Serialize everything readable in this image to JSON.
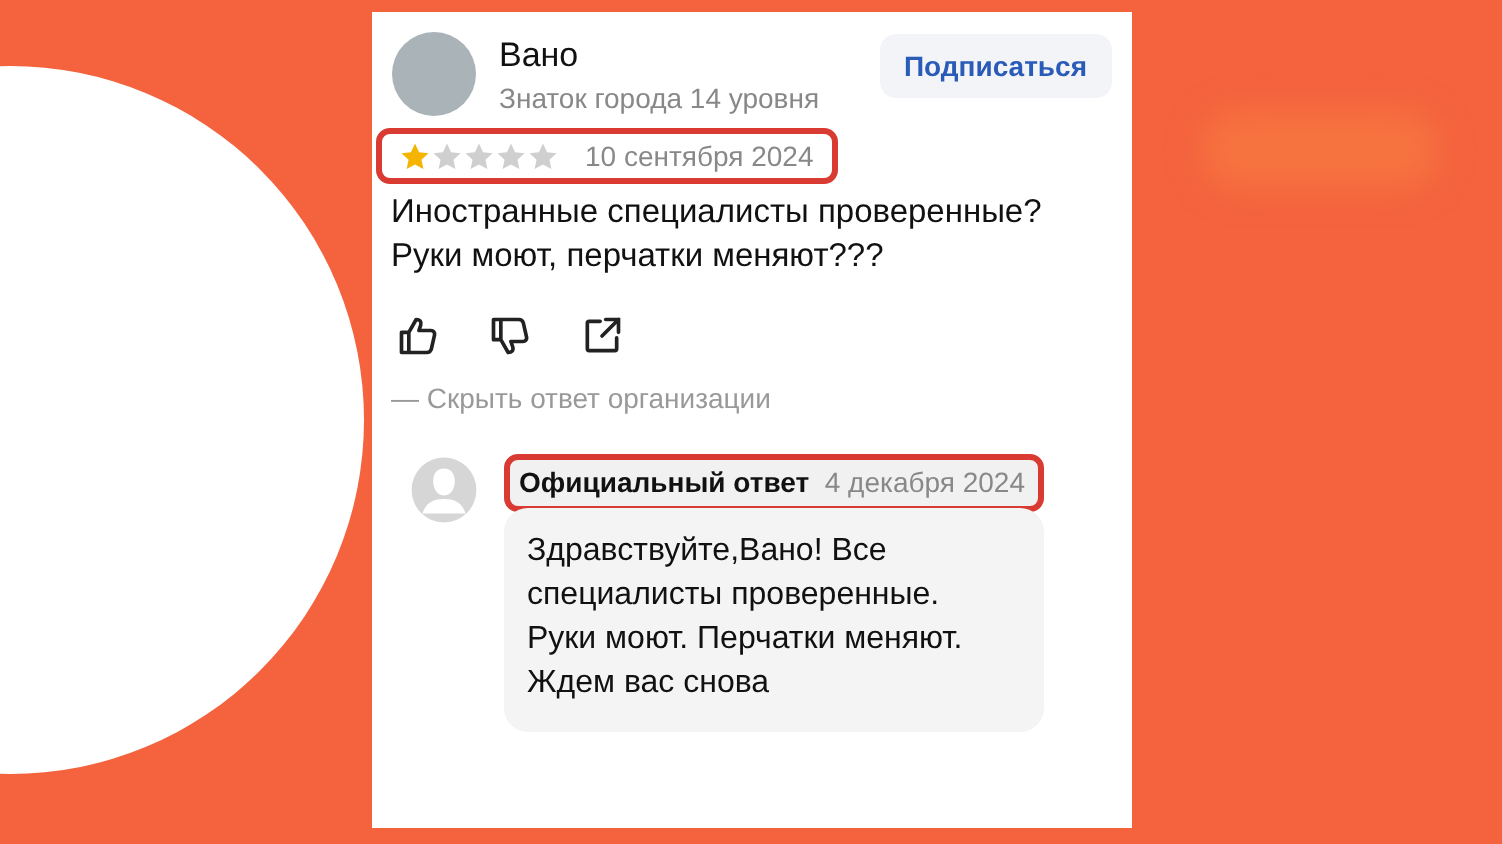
{
  "review": {
    "author": "Вано",
    "author_level": "Знаток города 14 уровня",
    "subscribe_button": "Подписаться",
    "stars": 1,
    "date": "10 сентября 2024",
    "highlighted": true,
    "text": "Иностранные специалисты проверенные?\nРуки моют, перчатки меняют???",
    "toggle_reply": "— Скрыть ответ организации"
  },
  "reply": {
    "title": "Официальный ответ",
    "date": "4 декабря 2024",
    "highlighted": true,
    "text": "Здравствуйте,Вано! Все\nспециалисты проверенные.\nРуки моют. Перчатки меняют.\nЖдем вас снова"
  }
}
